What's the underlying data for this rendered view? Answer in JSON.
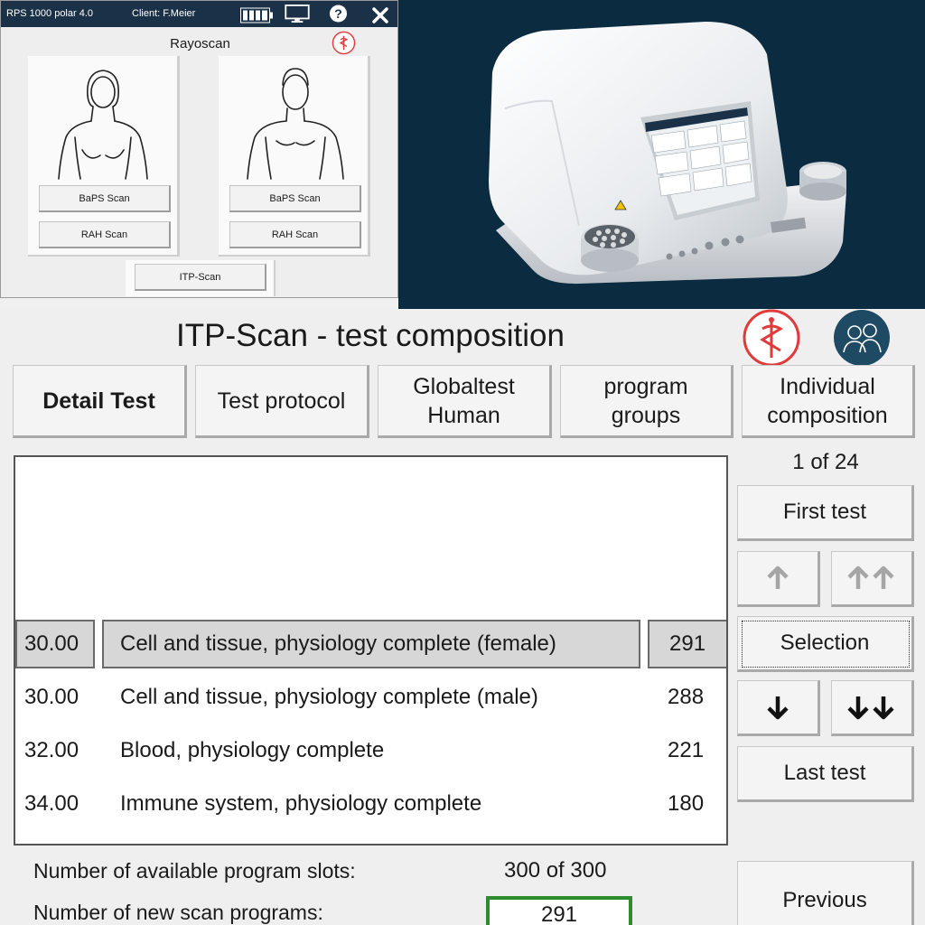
{
  "mini_app": {
    "titlebar": {
      "product": "RPS 1000 polar 4.0",
      "client": "Client: F.Meier",
      "icons": [
        "battery-icon",
        "monitor-icon",
        "help-icon",
        "close-icon"
      ]
    },
    "heading": "Rayoscan",
    "female_panel": {
      "baps_label": "BaPS Scan",
      "rah_label": "RAH Scan"
    },
    "male_panel": {
      "baps_label": "BaPS Scan",
      "rah_label": "RAH Scan"
    },
    "itp_label": "ITP-Scan"
  },
  "screen": {
    "title": "ITP-Scan - test composition",
    "tabs": [
      {
        "label": "Detail Test",
        "active": true
      },
      {
        "label": "Test protocol",
        "active": false
      },
      {
        "label": "Globaltest\nHuman",
        "active": false
      },
      {
        "label": "program\ngroups",
        "active": false
      },
      {
        "label": "Individual\ncomposition",
        "active": false
      }
    ],
    "list": {
      "rows": [
        {
          "code": "30.00",
          "name": "Cell and tissue, physiology complete (female)",
          "count": "291",
          "selected": true
        },
        {
          "code": "30.00",
          "name": "Cell and tissue, physiology complete (male)",
          "count": "288",
          "selected": false
        },
        {
          "code": "32.00",
          "name": "Blood, physiology complete",
          "count": "221",
          "selected": false
        },
        {
          "code": "34.00",
          "name": "Immune system, physiology complete",
          "count": "180",
          "selected": false
        }
      ]
    },
    "nav": {
      "counter": "1 of 24",
      "first_label": "First test",
      "selection_label": "Selection",
      "last_label": "Last test",
      "previous_label": "Previous"
    },
    "info": {
      "slots_label": "Number of available program slots:",
      "slots_value": "300 of 300",
      "new_label": "Number of new scan programs:",
      "new_value": "291"
    }
  },
  "colors": {
    "titlebar": "#1b3147",
    "photo_bg": "#0b2b40",
    "logo_red": "#e03a3a",
    "avatar_bg": "#1f4a63",
    "highlight_green": "#2e8b2e",
    "selected_row": "#d7d7d7"
  }
}
